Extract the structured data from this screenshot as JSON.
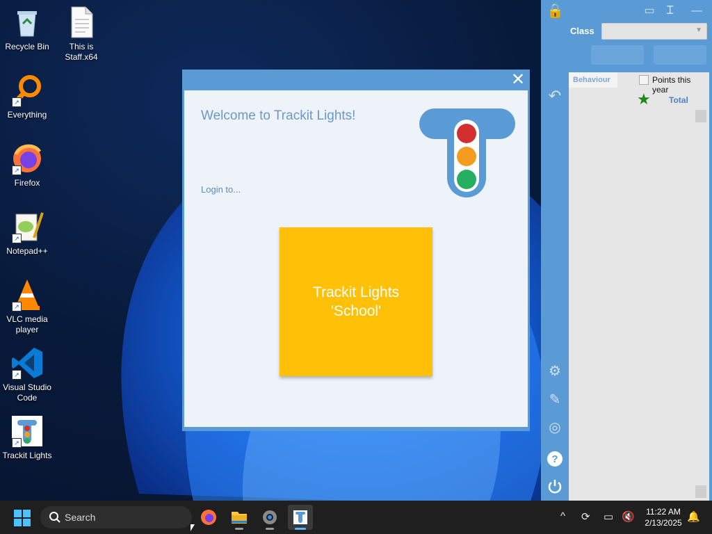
{
  "desktop": {
    "icons": [
      {
        "label": "Recycle Bin",
        "icon": "recycle-bin-icon",
        "shortcut": false
      },
      {
        "label": "This is Staff.x64",
        "icon": "text-file-icon",
        "shortcut": false
      },
      {
        "label": "Everything",
        "icon": "everything-search-icon",
        "shortcut": true
      },
      {
        "label": "Firefox",
        "icon": "firefox-icon",
        "shortcut": true
      },
      {
        "label": "Notepad++",
        "icon": "notepad-plus-plus-icon",
        "shortcut": true
      },
      {
        "label": "VLC media player",
        "icon": "vlc-icon",
        "shortcut": true
      },
      {
        "label": "Visual Studio Code",
        "icon": "vscode-icon",
        "shortcut": true
      },
      {
        "label": "Trackit Lights",
        "icon": "trackit-lights-icon",
        "shortcut": true
      }
    ]
  },
  "side_panel": {
    "class_label": "Class",
    "class_value": "",
    "tab_behaviour": "Behaviour",
    "points_label": "Points this year",
    "points_checked": false,
    "total_label": "Total"
  },
  "dialog": {
    "welcome": "Welcome to Trackit Lights!",
    "login_prompt": "Login to...",
    "school_button_line1": "Trackit Lights",
    "school_button_line2": "'School'"
  },
  "taskbar": {
    "search_placeholder": "Search",
    "time": "11:22 AM",
    "date": "2/13/2025"
  },
  "colors": {
    "accent_blue": "#5b9bd5",
    "school_yellow": "#ffc107",
    "light_red": "#d32f2f",
    "light_orange": "#f39c1f",
    "light_green": "#27ae60"
  }
}
